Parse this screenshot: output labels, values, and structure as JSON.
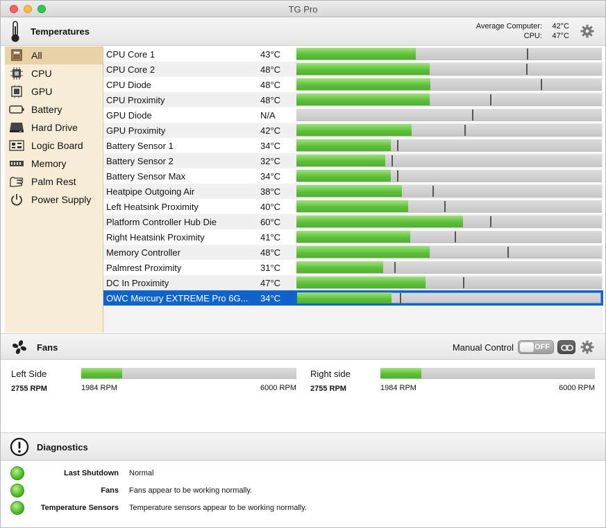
{
  "window": {
    "title": "TG Pro"
  },
  "temperatures": {
    "header": "Temperatures",
    "average_label": "Average Computer:",
    "average_value": "42°C",
    "cpu_label": "CPU:",
    "cpu_value": "47°C",
    "scale": {
      "min_c": 0,
      "max_c": 105
    },
    "sidebar": [
      {
        "label": "All",
        "icon": "computer-icon",
        "active": true
      },
      {
        "label": "CPU",
        "icon": "cpu-chip-icon"
      },
      {
        "label": "GPU",
        "icon": "gpu-chip-icon"
      },
      {
        "label": "Battery",
        "icon": "battery-icon"
      },
      {
        "label": "Hard Drive",
        "icon": "hard-drive-icon"
      },
      {
        "label": "Logic Board",
        "icon": "logic-board-icon"
      },
      {
        "label": "Memory",
        "icon": "memory-icon"
      },
      {
        "label": "Palm Rest",
        "icon": "palm-rest-icon"
      },
      {
        "label": "Power Supply",
        "icon": "power-icon"
      }
    ],
    "sensors": [
      {
        "name": "CPU Core 1",
        "value": "43°C",
        "level": 0.39,
        "max_marker": 0.755
      },
      {
        "name": "CPU Core 2",
        "value": "48°C",
        "level": 0.437,
        "max_marker": 0.753
      },
      {
        "name": "CPU Diode",
        "value": "48°C",
        "level": 0.439,
        "max_marker": 0.801
      },
      {
        "name": "CPU Proximity",
        "value": "48°C",
        "level": 0.437,
        "max_marker": 0.635
      },
      {
        "name": "GPU Diode",
        "value": "N/A",
        "level": 0,
        "max_marker": 0.576
      },
      {
        "name": "GPU Proximity",
        "value": "42°C",
        "level": 0.378,
        "max_marker": 0.549
      },
      {
        "name": "Battery Sensor 1",
        "value": "34°C",
        "level": 0.31,
        "max_marker": 0.33
      },
      {
        "name": "Battery Sensor 2",
        "value": "32°C",
        "level": 0.29,
        "max_marker": 0.312
      },
      {
        "name": "Battery Sensor Max",
        "value": "34°C",
        "level": 0.31,
        "max_marker": 0.33
      },
      {
        "name": "Heatpipe Outgoing Air",
        "value": "38°C",
        "level": 0.346,
        "max_marker": 0.446
      },
      {
        "name": "Left Heatsink Proximity",
        "value": "40°C",
        "level": 0.366,
        "max_marker": 0.485
      },
      {
        "name": "Platform Controller Hub Die",
        "value": "60°C",
        "level": 0.546,
        "max_marker": 0.635
      },
      {
        "name": "Right Heatsink Proximity",
        "value": "41°C",
        "level": 0.372,
        "max_marker": 0.519
      },
      {
        "name": "Memory Controller",
        "value": "48°C",
        "level": 0.437,
        "max_marker": 0.69
      },
      {
        "name": "Palmrest Proximity",
        "value": "31°C",
        "level": 0.283,
        "max_marker": 0.321
      },
      {
        "name": "DC In Proximity",
        "value": "47°C",
        "level": 0.423,
        "max_marker": 0.546
      },
      {
        "name": "OWC Mercury EXTREME Pro 6G...",
        "value": "34°C",
        "level": 0.31,
        "max_marker": 0.337,
        "selected": true
      }
    ]
  },
  "fans": {
    "header": "Fans",
    "manual_control_label": "Manual Control",
    "manual_toggle_text": "OFF",
    "items": [
      {
        "name": "Left Side",
        "rpm": "2755 RPM",
        "min": "1984 RPM",
        "max": "6000 RPM",
        "level": 0.19
      },
      {
        "name": "Right side",
        "rpm": "2755 RPM",
        "min": "1984 RPM",
        "max": "6000 RPM",
        "level": 0.19
      }
    ]
  },
  "diagnostics": {
    "header": "Diagnostics",
    "items": [
      {
        "label": "Last Shutdown",
        "message": "Normal",
        "status_color": "#4cbb24"
      },
      {
        "label": "Fans",
        "message": "Fans appear to be working normally.",
        "status_color": "#4cbb24"
      },
      {
        "label": "Temperature Sensors",
        "message": "Temperature sensors appear to be working normally.",
        "status_color": "#4cbb24"
      }
    ]
  },
  "colors": {
    "accent": "#0f63c9",
    "bar_fill": "#5fc13a",
    "sidebar_bg": "#f7ecd6",
    "sidebar_active": "#e9d2a6"
  }
}
